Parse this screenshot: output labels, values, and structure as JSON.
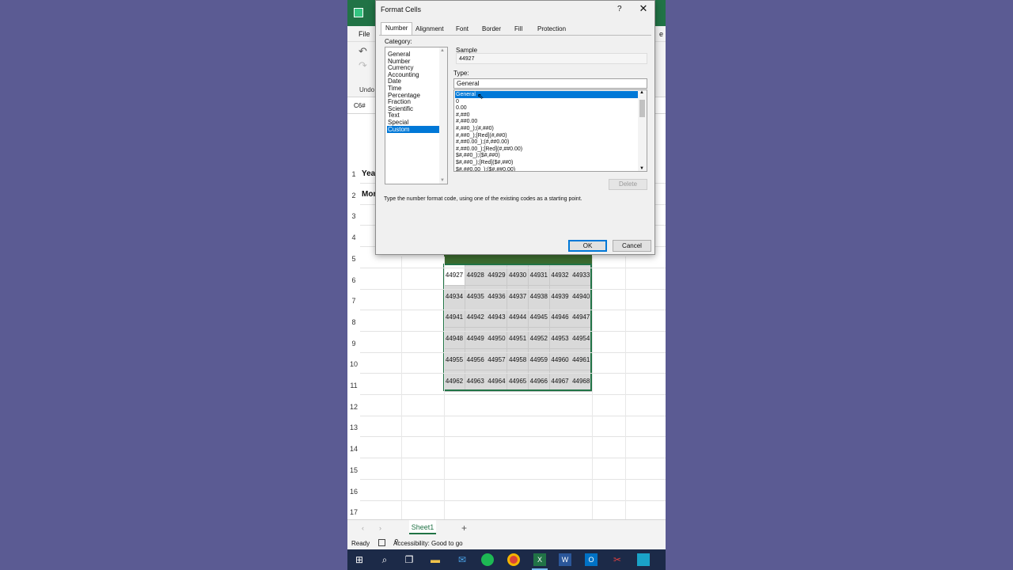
{
  "app": {
    "ribbon_tab_file": "File",
    "ribbon_tab_edge": "e",
    "undo_label": "Undo",
    "name_box": "C6#"
  },
  "grid": {
    "row_numbers": [
      "1",
      "2",
      "3",
      "4",
      "5",
      "6",
      "7",
      "8",
      "9",
      "10",
      "11",
      "12",
      "13",
      "14",
      "15",
      "16",
      "17"
    ],
    "row1_label": "Year",
    "row2_label": "Mor",
    "values": [
      [
        "44927",
        "44928",
        "44929",
        "44930",
        "44931",
        "44932",
        "44933"
      ],
      [
        "44934",
        "44935",
        "44936",
        "44937",
        "44938",
        "44939",
        "44940"
      ],
      [
        "44941",
        "44942",
        "44943",
        "44944",
        "44945",
        "44946",
        "44947"
      ],
      [
        "44948",
        "44949",
        "44950",
        "44951",
        "44952",
        "44953",
        "44954"
      ],
      [
        "44955",
        "44956",
        "44957",
        "44958",
        "44959",
        "44960",
        "44961"
      ],
      [
        "44962",
        "44963",
        "44964",
        "44965",
        "44966",
        "44967",
        "44968"
      ]
    ]
  },
  "sheet_tab": "Sheet1",
  "add_sheet_label": "+",
  "status": {
    "ready": "Ready",
    "accessibility": "Accessibility: Good to go"
  },
  "dialog": {
    "title": "Format Cells",
    "help": "?",
    "close": "✕",
    "tabs": [
      "Number",
      "Alignment",
      "Font",
      "Border",
      "Fill",
      "Protection"
    ],
    "selected_tab": "Number",
    "category_label": "Category:",
    "categories": [
      "General",
      "Number",
      "Currency",
      "Accounting",
      "Date",
      "Time",
      "Percentage",
      "Fraction",
      "Scientific",
      "Text",
      "Special",
      "Custom"
    ],
    "selected_category": "Custom",
    "sample_label": "Sample",
    "sample_value": "44927",
    "type_label": "Type:",
    "type_value": "General",
    "type_options": [
      "General",
      "0",
      "0.00",
      "#,##0",
      "#,##0.00",
      "#,##0_);(#,##0)",
      "#,##0_);[Red](#,##0)",
      "#,##0.00_);(#,##0.00)",
      "#,##0.00_);[Red](#,##0.00)",
      "$#,##0_);($#,##0)",
      "$#,##0_);[Red]($#,##0)",
      "$#,##0.00_);($#,##0.00)"
    ],
    "selected_type": "General",
    "delete_label": "Delete",
    "hint": "Type the number format code, using one of the existing codes as a starting point.",
    "ok_label": "OK",
    "cancel_label": "Cancel"
  },
  "colors": {
    "excel_green": "#217346",
    "selection_blue": "#0078d7",
    "background": "#5b5b93"
  },
  "taskbar_icons": [
    "windows-icon",
    "search-icon",
    "task-view-icon",
    "file-explorer-icon",
    "mail-icon",
    "spotify-icon",
    "chrome-icon",
    "excel-icon",
    "word-icon",
    "outlook-icon",
    "snipping-icon",
    "app-icon"
  ]
}
